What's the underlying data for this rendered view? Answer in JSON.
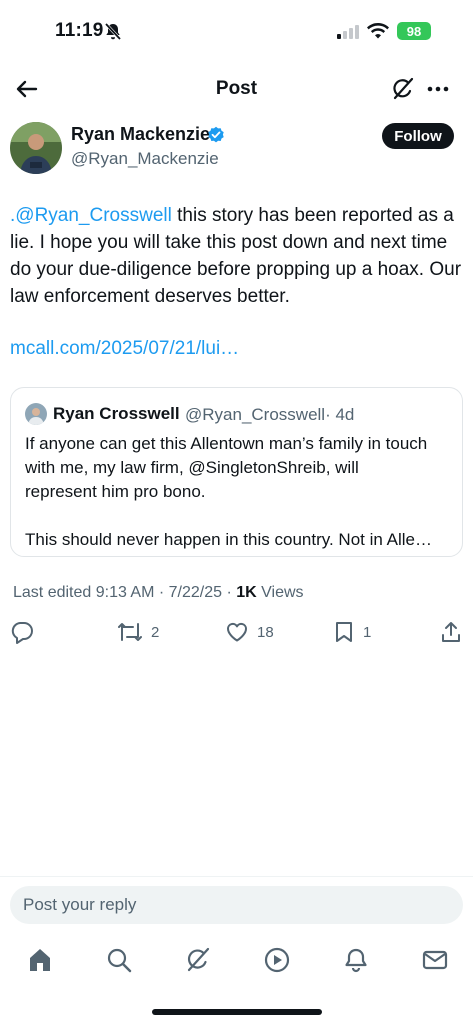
{
  "status_bar": {
    "time": "11:19",
    "battery": "98"
  },
  "header": {
    "title": "Post"
  },
  "author": {
    "name": "Ryan Mackenzie",
    "handle": "@Ryan_Mackenzie",
    "verified": true,
    "follow_label": "Follow"
  },
  "post": {
    "mention": ".@Ryan_Crosswell",
    "text": " this story has been reported as a lie. I hope you will take this post down and next time do your due-diligence before propping up a hoax. Our law enforcement deserves better.",
    "link": "mcall.com/2025/07/21/lui…"
  },
  "quote": {
    "name": "Ryan Crosswell",
    "handle": "@Ryan_Crosswell",
    "age": "· 4d",
    "lines": [
      "If anyone can get this Allentown man’s family in touch",
      "with me, my law firm, @SingletonShreib, will",
      "represent him pro bono.",
      "This should never happen in this country. Not in Alle…"
    ]
  },
  "meta": {
    "edited": "Last edited 9:13 AM · 7/22/25",
    "separator": " · ",
    "views_count": "1K",
    "views_label": " Views"
  },
  "actions": {
    "replies": "",
    "reposts": "2",
    "likes": "18",
    "bookmarks": "1"
  },
  "reply": {
    "placeholder": "Post your reply"
  },
  "nav": {
    "items": [
      "home-icon",
      "search-icon",
      "grok-icon",
      "video-icon",
      "notifications-icon",
      "messages-icon"
    ]
  },
  "colors": {
    "accent": "#1d9bf0",
    "text": "#0f1419",
    "secondary": "#536471",
    "battery": "#34c759"
  }
}
